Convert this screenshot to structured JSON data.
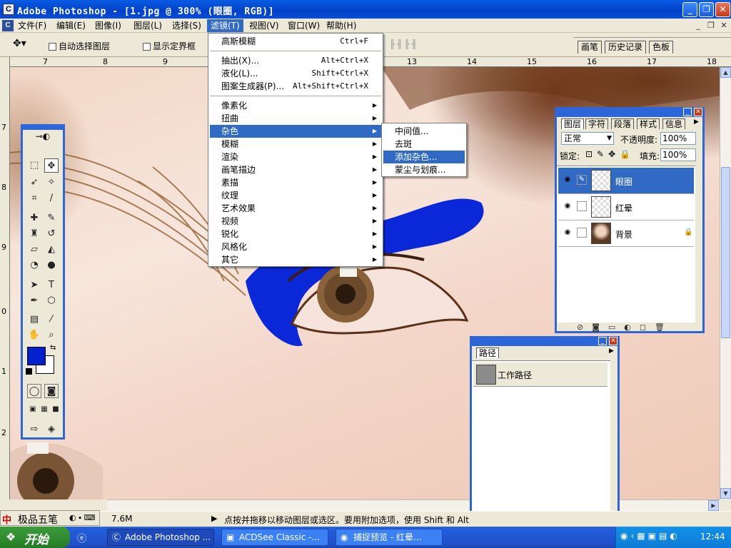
{
  "window": {
    "title": "Adobe Photoshop - [1.jpg @ 300% (眼圈, RGB)]",
    "logo": "C",
    "controls": {
      "minimize": "_",
      "restore": "❐",
      "close": "✕"
    }
  },
  "menubar": {
    "items": [
      "文件(F)",
      "编辑(E)",
      "图像(I)",
      "图层(L)",
      "选择(S)",
      "滤镜(T)",
      "视图(V)",
      "窗口(W)",
      "帮助(H)"
    ],
    "active_index": 5,
    "mdi": {
      "minimize": "_",
      "restore": "❐",
      "close": "✕"
    }
  },
  "optionsbar": {
    "auto_select_layer": "自动选择图层",
    "show_bounding_box": "显示定界框",
    "well_tabs": [
      "画笔",
      "历史记录",
      "色板"
    ]
  },
  "rulers": {
    "top": [
      "7",
      "8",
      "9",
      "13",
      "14",
      "15",
      "16",
      "17",
      "18"
    ],
    "left": [
      "7",
      "8",
      "9",
      "0",
      "1",
      "2"
    ]
  },
  "filter_menu": {
    "items": [
      {
        "label": "高斯模糊",
        "shortcut": "Ctrl+F"
      },
      {
        "sep": true
      },
      {
        "label": "抽出(X)...",
        "shortcut": "Alt+Ctrl+X"
      },
      {
        "label": "液化(L)...",
        "shortcut": "Shift+Ctrl+X"
      },
      {
        "label": "图案生成器(P)...",
        "shortcut": "Alt+Shift+Ctrl+X"
      },
      {
        "sep": true
      },
      {
        "label": "像素化",
        "submenu": true
      },
      {
        "label": "扭曲",
        "submenu": true
      },
      {
        "label": "杂色",
        "submenu": true,
        "highlighted": true
      },
      {
        "label": "模糊",
        "submenu": true
      },
      {
        "label": "渲染",
        "submenu": true
      },
      {
        "label": "画笔描边",
        "submenu": true
      },
      {
        "label": "素描",
        "submenu": true
      },
      {
        "label": "纹理",
        "submenu": true
      },
      {
        "label": "艺术效果",
        "submenu": true
      },
      {
        "label": "视频",
        "submenu": true
      },
      {
        "label": "锐化",
        "submenu": true
      },
      {
        "label": "风格化",
        "submenu": true
      },
      {
        "label": "其它",
        "submenu": true
      }
    ]
  },
  "noise_submenu": {
    "items": [
      {
        "label": "中间值..."
      },
      {
        "label": "去斑"
      },
      {
        "label": "添加杂色...",
        "highlighted": true
      },
      {
        "label": "蒙尘与划痕..."
      }
    ]
  },
  "layers_panel": {
    "tabs": [
      "图层",
      "字符",
      "段落",
      "样式",
      "信息"
    ],
    "blend_mode": "正常",
    "opacity_label": "不透明度:",
    "opacity_value": "100%",
    "lock_label": "锁定:",
    "fill_label": "填充:",
    "fill_value": "100%",
    "layers": [
      {
        "name": "眼圈",
        "selected": true
      },
      {
        "name": "红晕",
        "selected": false
      },
      {
        "name": "背景",
        "selected": false,
        "locked": true
      }
    ]
  },
  "paths_panel": {
    "tab": "路径",
    "paths": [
      {
        "name": "工作路径"
      }
    ]
  },
  "statusbar": {
    "ime_name": "极品五笔",
    "doc_size": "7.6M",
    "hint": "点按并拖移以移动图层或选区。要用附加选项，使用 Shift 和 Alt"
  },
  "taskbar": {
    "start": "开始",
    "tasks": [
      "Adobe Photoshop ...",
      "ACDSee Classic -...",
      "捕捉预览 - 红晕..."
    ],
    "active_task": 0,
    "clock": "12:44"
  },
  "colors": {
    "foreground": "#0022cc",
    "background": "#ffffff",
    "paint_blue": "#0a28d8",
    "accent": "#316ac5"
  }
}
